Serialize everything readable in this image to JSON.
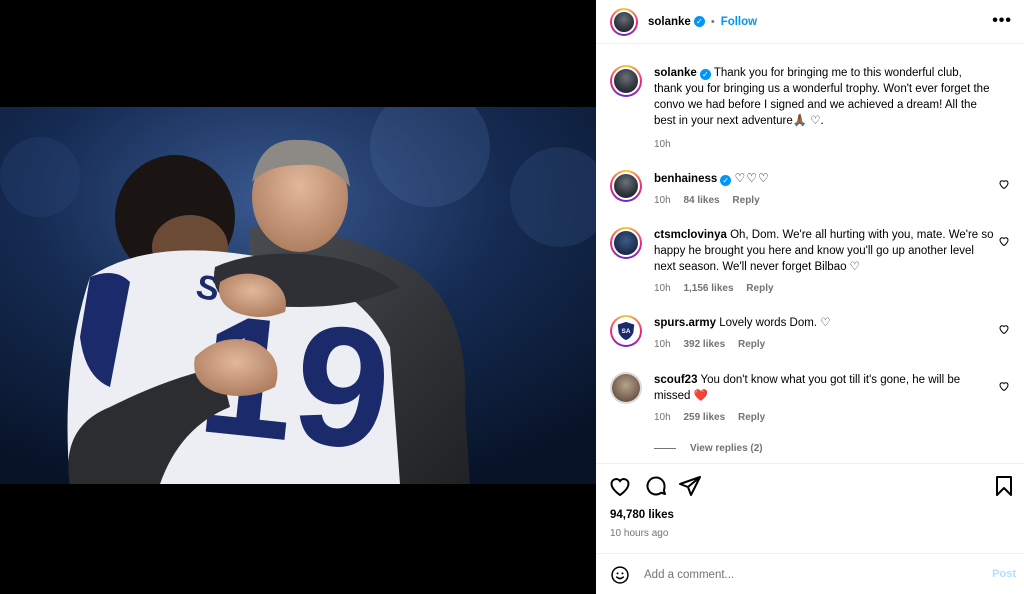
{
  "post": {
    "author": "solanke",
    "follow_label": "Follow",
    "separator": "•",
    "more_label": "•••"
  },
  "caption": {
    "username": "solanke",
    "text": "Thank you for bringing me to this wonderful club, thank you for bringing us a wonderful trophy. Won't ever forget the convo we had before I signed and we achieved a dream! All the best in your next adventure🙏🏾 ♡.",
    "time": "10h"
  },
  "comments": [
    {
      "username": "benhainess",
      "verified": true,
      "text": "♡♡♡",
      "time": "10h",
      "likes": "84 likes",
      "reply": "Reply"
    },
    {
      "username": "ctsmclovinya",
      "verified": false,
      "text": "Oh, Dom. We're all hurting with you, mate. We're so happy he brought you here and know you'll go up another level next season. We'll never forget Bilbao ♡",
      "time": "10h",
      "likes": "1,156 likes",
      "reply": "Reply"
    },
    {
      "username": "spurs.army",
      "verified": false,
      "text": "Lovely words Dom. ♡",
      "time": "10h",
      "likes": "392 likes",
      "reply": "Reply"
    },
    {
      "username": "scouf23",
      "verified": false,
      "text": "You don't know what you got till it's gone, he will be missed ❤️",
      "time": "10h",
      "likes": "259 likes",
      "reply": "Reply"
    }
  ],
  "view_replies": "View replies (2)",
  "stats": {
    "likes": "94,780 likes",
    "time_ago": "10 hours ago"
  },
  "add_comment": {
    "placeholder": "Add a comment...",
    "post_label": "Post"
  },
  "icons": {
    "like": "heart-icon",
    "comment": "comment-icon",
    "share": "share-icon",
    "save": "bookmark-icon",
    "emoji": "smile-icon",
    "verified": "verified-badge-icon",
    "more": "more-options-icon"
  },
  "colors": {
    "link_blue": "#0095f6",
    "verified_blue": "#0095f6",
    "muted_text": "#737373",
    "post_disabled": "#b2dffc",
    "heart_red": "#ed4956",
    "kit_navy": "#1b2a6b"
  }
}
